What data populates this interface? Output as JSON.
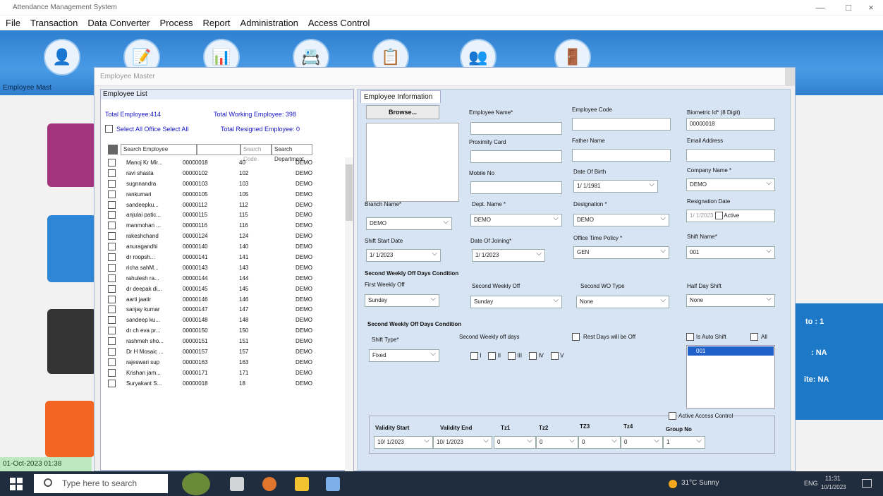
{
  "window": {
    "title": "Attendance Management System",
    "controls": [
      "—",
      "□",
      "×"
    ]
  },
  "menu": [
    "File",
    "Transaction",
    "Data Converter",
    "Process",
    "Report",
    "Administration",
    "Access Control"
  ],
  "ribbon": {
    "label": "Employee Mast"
  },
  "status": {
    "datetime": "01-Oct-2023 01:38"
  },
  "info_panel": {
    "line1": "to : 1",
    "line2": ": NA",
    "line3": "ite: NA"
  },
  "dialog": {
    "title": "Employee Master"
  },
  "employee_list": {
    "header": "Employee List",
    "total_employee": "Total Employee:414",
    "total_working": "Total Working Employee: 398",
    "select_all": "Select All Office Select All",
    "total_resigned": "Total Resigned Employee: 0",
    "search_employee": "Search Employee",
    "search_code": "Search Code",
    "search_department": "Search Department",
    "rows": [
      {
        "name": "Manoj Kr Mir...",
        "code": "00000018",
        "id": "40",
        "branch": "DEMO"
      },
      {
        "name": "ravi shasta",
        "code": "00000102",
        "id": "102",
        "branch": "DEMO"
      },
      {
        "name": "sugnnandra",
        "code": "00000103",
        "id": "103",
        "branch": "DEMO"
      },
      {
        "name": "rankumari",
        "code": "00000105",
        "id": "105",
        "branch": "DEMO"
      },
      {
        "name": "sandeepku...",
        "code": "00000112",
        "id": "112",
        "branch": "DEMO"
      },
      {
        "name": "anjulai patic...",
        "code": "00000115",
        "id": "115",
        "branch": "DEMO"
      },
      {
        "name": "manmohan ...",
        "code": "00000116",
        "id": "116",
        "branch": "DEMO"
      },
      {
        "name": "rakeshchand",
        "code": "00000124",
        "id": "124",
        "branch": "DEMO"
      },
      {
        "name": "anuragandhi",
        "code": "00000140",
        "id": "140",
        "branch": "DEMO"
      },
      {
        "name": "dr roopsh...",
        "code": "00000141",
        "id": "141",
        "branch": "DEMO"
      },
      {
        "name": "richa sahM...",
        "code": "00000143",
        "id": "143",
        "branch": "DEMO"
      },
      {
        "name": "rahulesh ra...",
        "code": "00000144",
        "id": "144",
        "branch": "DEMO"
      },
      {
        "name": "dr deepak di...",
        "code": "00000145",
        "id": "145",
        "branch": "DEMO"
      },
      {
        "name": "aarti jaatir",
        "code": "00000146",
        "id": "146",
        "branch": "DEMO"
      },
      {
        "name": "sanjay kumar",
        "code": "00000147",
        "id": "147",
        "branch": "DEMO"
      },
      {
        "name": "sandeep ku...",
        "code": "00000148",
        "id": "148",
        "branch": "DEMO"
      },
      {
        "name": "dr ch eva pr...",
        "code": "00000150",
        "id": "150",
        "branch": "DEMO"
      },
      {
        "name": "rashmeh sho...",
        "code": "00000151",
        "id": "151",
        "branch": "DEMO"
      },
      {
        "name": "Dr H Mosaic ...",
        "code": "00000157",
        "id": "157",
        "branch": "DEMO"
      },
      {
        "name": "rajeswari sup",
        "code": "00000163",
        "id": "163",
        "branch": "DEMO"
      },
      {
        "name": "Krishan jam...",
        "code": "00000171",
        "id": "171",
        "branch": "DEMO"
      },
      {
        "name": "Suryakant S...",
        "code": "00000018",
        "id": "18",
        "branch": "DEMO"
      }
    ]
  },
  "form": {
    "tab": "Employee Information",
    "browse": "Browse...",
    "employee_name_label": "Employee Name*",
    "employee_name": "",
    "employee_code_label": "Employee Code",
    "employee_code": "",
    "biometric_label": "Biometric Id* (8 Digit)",
    "biometric": "00000018",
    "proximity_label": "Proximity Card",
    "proximity": "",
    "father_label": "Father Name",
    "father": "",
    "email_label": "Email Address",
    "email": "",
    "mobile_label": "Mobile No",
    "mobile": "",
    "dob_label": "Date Of Birth",
    "dob": "1/ 1/1981",
    "company_label": "Company Name *",
    "company": "DEMO",
    "branch_label": "Branch Name*",
    "branch": "DEMO",
    "dept_label": "Dept. Name *",
    "dept": "DEMO",
    "designation_label": "Designation *",
    "designation": "DEMO",
    "resign_label": "Resignation Date",
    "resign": "1/ 1/2023",
    "resign_check": "Active",
    "shift_start_label": "Shift Start Date",
    "shift_start": "1/ 1/2023",
    "doj_label": "Date Of Joining*",
    "doj": "1/ 1/2023",
    "office_policy_label": "Office Time Policy *",
    "office_policy": "GEN",
    "shift_name_label": "Shift Name*",
    "shift_name": "001",
    "second_wo_section": "Second Weekly Off Days Condition",
    "first_wo_label": "First Weekly Off",
    "first_wo": "Sunday",
    "second_wo_label": "Second Weekly Off",
    "second_wo": "Sunday",
    "second_wo_type_label": "Second WO Type",
    "second_wo_type": "None",
    "half_day_label": "Half Day Shift",
    "half_day": "None",
    "second_wo_section2": "Second Weekly Off Days Condition",
    "shift_type_label": "Shift Type*",
    "shift_type": "Fixed",
    "second_days_label": "Second Weekly off days",
    "rest_days_label": "Rest Days will be Off",
    "weeks": [
      "I",
      "II",
      "III",
      "IV",
      "V"
    ],
    "auto_shift_label": "Is Auto Shift",
    "all_label": "All",
    "shift_list_item": "001",
    "access_label": "Active Access Control",
    "access": {
      "validity_start_label": "Validity Start",
      "validity_start": "10/ 1/2023",
      "validity_end_label": "Validity End",
      "validity_end": "10/ 1/2023",
      "tz1_label": "Tz1",
      "tz1": "0",
      "tz2_label": "Tz2",
      "tz2": "0",
      "tz3_label": "TZ3",
      "tz3": "0",
      "tz4_label": "Tz4",
      "tz4": "0",
      "group_label": "Group No",
      "group": "1"
    }
  },
  "taskbar": {
    "search_placeholder": "Type here to search",
    "weather": "31°C Sunny",
    "lang": "ENG",
    "time": "11:31",
    "date": "10/1/2023"
  },
  "colors": {
    "ribbon": "#2f7fcf",
    "form_bg": "#d7e4f3",
    "taskbar": "#1f2d3f"
  }
}
